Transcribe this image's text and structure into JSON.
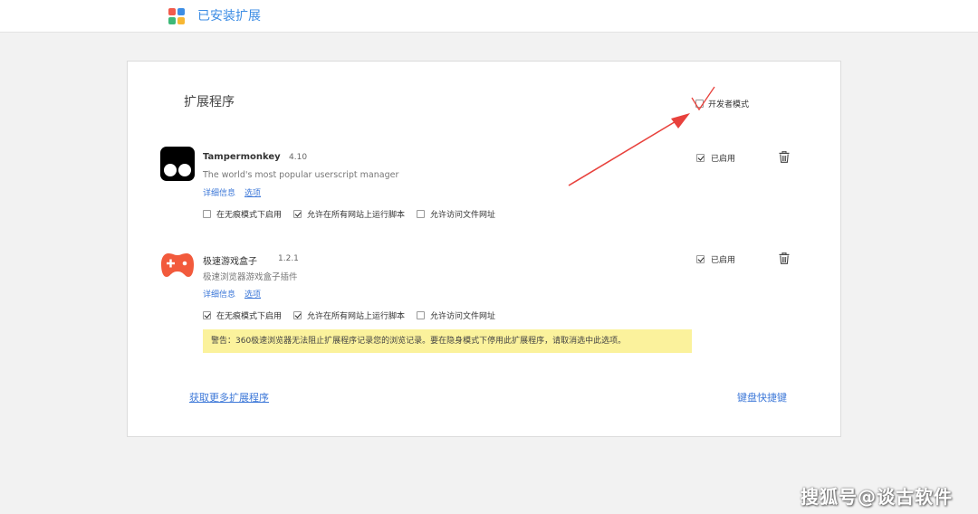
{
  "header": {
    "title": "已安装扩展",
    "logo_icon": "extensions-grid-icon"
  },
  "page": {
    "section_title": "扩展程序",
    "developer_mode_label": "开发者模式",
    "developer_mode_checked": false
  },
  "extensions": [
    {
      "name": "Tampermonkey",
      "version": "4.10",
      "description": "The world's most popular userscript manager",
      "links": [
        "详细信息",
        "选项"
      ],
      "options": [
        {
          "label": "在无痕模式下启用",
          "checked": false
        },
        {
          "label": "允许在所有网站上运行脚本",
          "checked": true
        },
        {
          "label": "允许访问文件网址",
          "checked": false
        }
      ],
      "enabled_label": "已启用",
      "enabled": true,
      "icon": "tampermonkey-icon"
    },
    {
      "name": "极速游戏盒子",
      "version": "1.2.1",
      "description": "极速浏览器游戏盒子插件",
      "links": [
        "详细信息",
        "选项"
      ],
      "options": [
        {
          "label": "在无痕模式下启用",
          "checked": true
        },
        {
          "label": "允许在所有网站上运行脚本",
          "checked": true
        },
        {
          "label": "允许访问文件网址",
          "checked": false
        }
      ],
      "enabled_label": "已启用",
      "enabled": true,
      "icon": "gamepad-icon",
      "warning": "警告：360极速浏览器无法阻止扩展程序记录您的浏览记录。要在隐身模式下停用此扩展程序，请取消选中此选项。"
    }
  ],
  "footer": {
    "more_extensions": "获取更多扩展程序",
    "keyboard_shortcuts": "键盘快捷键"
  },
  "watermark": "搜狐号@谈古软件",
  "colors": {
    "accent": "#3d8de4",
    "link": "#3d78d8",
    "warning_bg": "#fbf29c",
    "annotation": "#e8413c"
  }
}
